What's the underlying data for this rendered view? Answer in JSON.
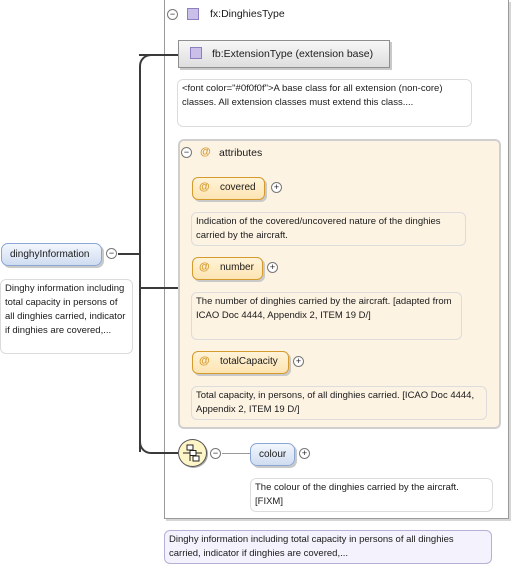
{
  "type_box": {
    "title": "fx:DinghiesType",
    "extension_label": "fb:ExtensionType (extension base)",
    "extension_doc": "<font color=\"#0f0f0f\">A base class for all extension (non-core) classes. All extension classes must extend this class...."
  },
  "attributes": {
    "header": "attributes",
    "items": [
      {
        "name": "covered",
        "doc": "Indication of the covered/uncovered nature of the dinghies carried by the aircraft."
      },
      {
        "name": "number",
        "doc": "The number of dinghies carried by the aircraft. [adapted from ICAO Doc 4444, Appendix 2, ITEM 19 D/]"
      },
      {
        "name": "totalCapacity",
        "doc": "Total capacity, in persons, of all dinghies carried. [ICAO Doc 4444, Appendix 2, ITEM 19 D/]"
      }
    ]
  },
  "root_element": {
    "name": "dinghyInformation",
    "doc": "Dinghy information including total capacity in persons of all dinghies carried, indicator if dinghies are covered,..."
  },
  "colour_element": {
    "name": "colour",
    "doc": "The colour of the dinghies carried by the aircraft. [FIXM]"
  },
  "type_footer_doc": "Dinghy information including total capacity in persons of all dinghies carried, indicator if dinghies are covered,...",
  "toggles": {
    "collapse": "⊖",
    "expand": "⊕"
  },
  "colors": {
    "attr_border": "#d49a2e",
    "attr_fill": "#fde4b2",
    "element_border": "#8aa7d4",
    "element_fill": "#cfdcf1",
    "type_icon": "#b7a9da"
  }
}
